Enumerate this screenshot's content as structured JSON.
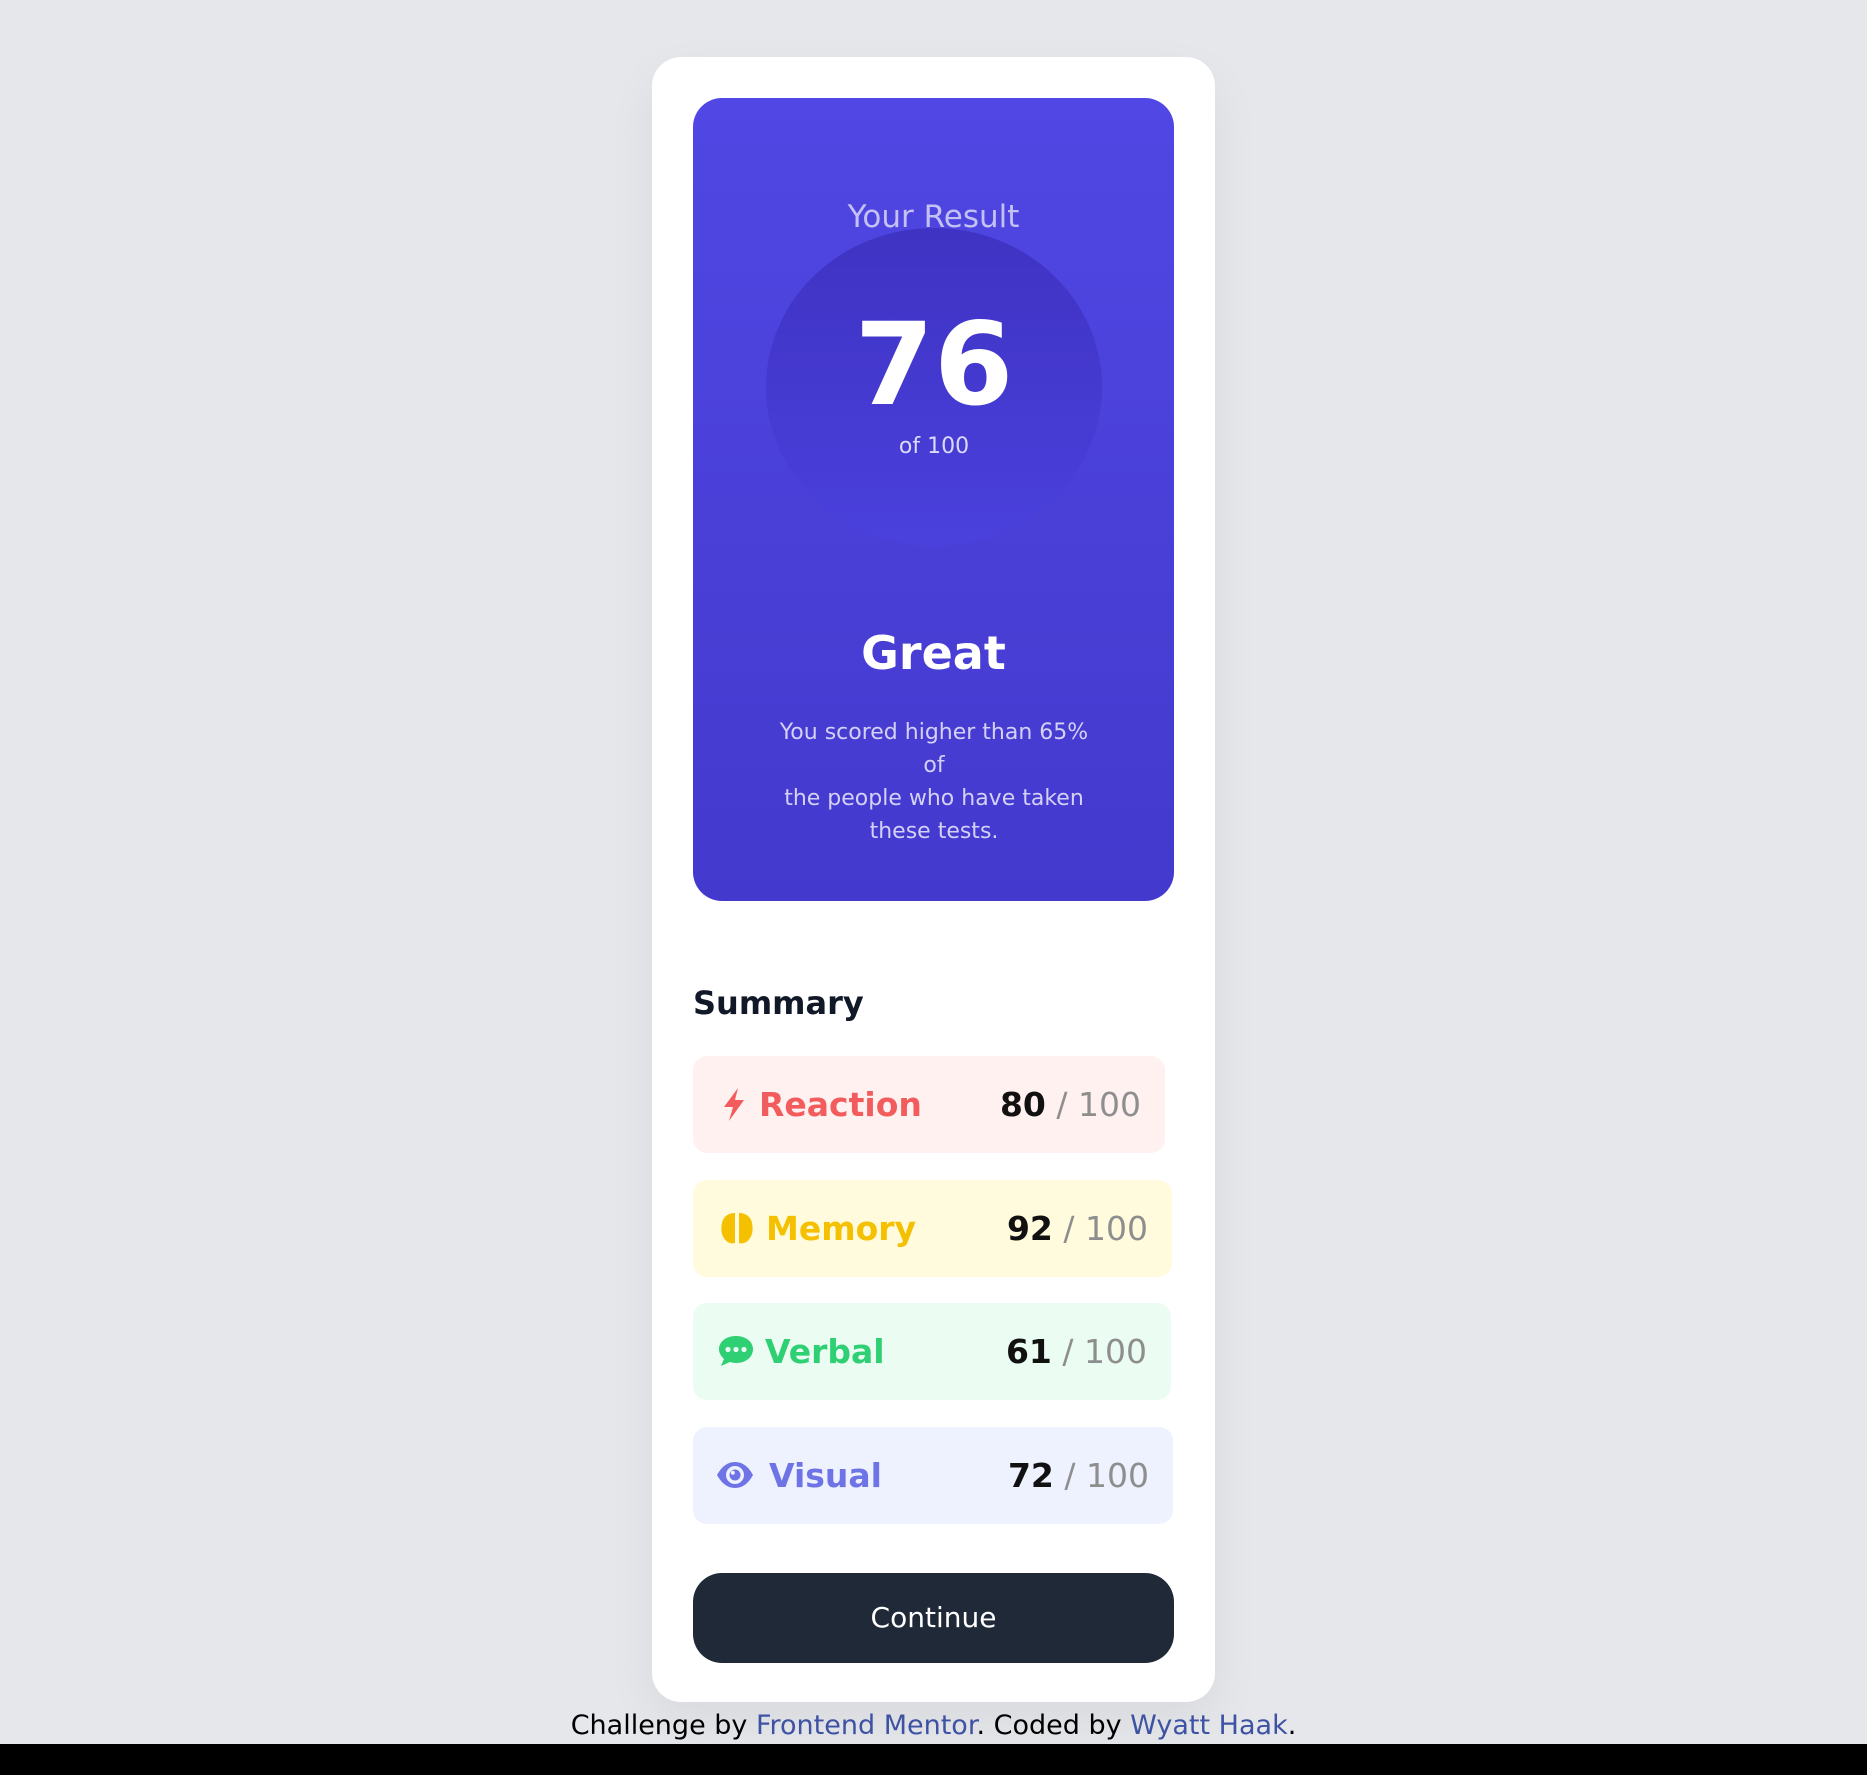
{
  "result": {
    "title": "Your Result",
    "score": "76",
    "score_of": "of 100",
    "rating": "Great",
    "description": "You scored higher than 65% of\nthe people who have taken these tests."
  },
  "summary": {
    "title": "Summary",
    "items": [
      {
        "label": "Reaction",
        "score": "80",
        "max": "/ 100",
        "icon": "lightning-icon",
        "color": "#f25c5c",
        "bg": "#fff1f0"
      },
      {
        "label": "Memory",
        "score": "92",
        "max": "/ 100",
        "icon": "brain-icon",
        "color": "#f5c000",
        "bg": "#fffbdc"
      },
      {
        "label": "Verbal",
        "score": "61",
        "max": "/ 100",
        "icon": "chat-bubble-icon",
        "color": "#2fcf73",
        "bg": "#ebfcf3"
      },
      {
        "label": "Visual",
        "score": "72",
        "max": "/ 100",
        "icon": "eye-icon",
        "color": "#6e73e6",
        "bg": "#eef1fe"
      }
    ]
  },
  "continue_label": "Continue",
  "footer": {
    "prefix": "Challenge by ",
    "link1": "Frontend Mentor",
    "middle": ". Coded by ",
    "link2": "Wyatt Haak",
    "suffix": "."
  },
  "colors": {
    "page_bg": "#e5e7eb",
    "result_gradient_top": "#5047e4",
    "result_gradient_bottom": "#4439cd",
    "button_bg": "#1f2937",
    "link": "#3e52a3"
  }
}
